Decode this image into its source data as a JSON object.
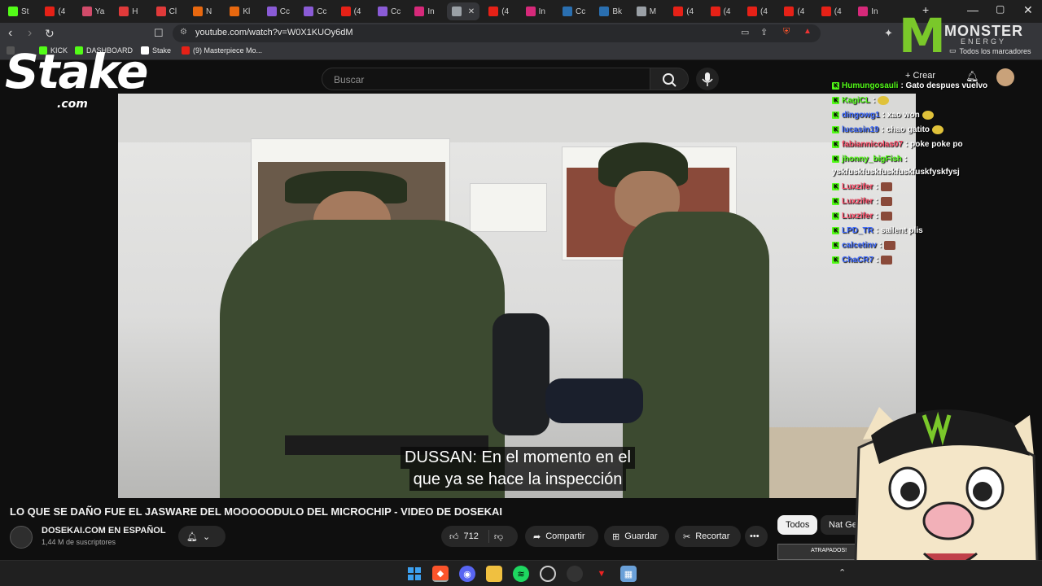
{
  "tabs": [
    {
      "label": "St",
      "color": "#53fc18"
    },
    {
      "label": "(4",
      "color": "#e62117"
    },
    {
      "label": "Ya",
      "color": "#d14b6a"
    },
    {
      "label": "H",
      "color": "#e03a3a"
    },
    {
      "label": "Cl",
      "color": "#e03a3a"
    },
    {
      "label": "N",
      "color": "#e8680f"
    },
    {
      "label": "Kl",
      "color": "#e8680f"
    },
    {
      "label": "Cc",
      "color": "#8a5bd6"
    },
    {
      "label": "Cc",
      "color": "#8a5bd6"
    },
    {
      "label": "(4",
      "color": "#e62117"
    },
    {
      "label": "Cc",
      "color": "#8a5bd6"
    },
    {
      "label": "In",
      "color": "#d6297a"
    },
    {
      "label": "",
      "color": "#9aa0a6",
      "active": true
    },
    {
      "label": "(4",
      "color": "#e62117"
    },
    {
      "label": "In",
      "color": "#d6297a"
    },
    {
      "label": "Cc",
      "color": "#2a6fb0"
    },
    {
      "label": "Bk",
      "color": "#2a6fb0"
    },
    {
      "label": "M",
      "color": "#9aa0a6"
    },
    {
      "label": "(4",
      "color": "#e62117"
    },
    {
      "label": "(4",
      "color": "#e62117"
    },
    {
      "label": "(4",
      "color": "#e62117"
    },
    {
      "label": "(4",
      "color": "#e62117"
    },
    {
      "label": "(4",
      "color": "#e62117"
    },
    {
      "label": "In",
      "color": "#d6297a"
    }
  ],
  "address": {
    "url": "youtube.com/watch?v=W0X1KUOy6dM"
  },
  "bookmarks": [
    {
      "label": "KICK",
      "color": "#53fc18"
    },
    {
      "label": "DASHBOARD",
      "color": "#53fc18"
    },
    {
      "label": "Stake",
      "color": "#1a2c38"
    },
    {
      "label": "(9) Masterpiece Mo...",
      "color": "#e62117"
    }
  ],
  "bookmarks_all": "Todos los marcadores",
  "search": {
    "placeholder": "Buscar"
  },
  "create_label": "Crear",
  "stake": {
    "word": "Stake",
    "domain": ".com"
  },
  "monster": {
    "word": "MONSTER",
    "sub": "ENERGY"
  },
  "chat": [
    {
      "user": "Humungosauli",
      "msg": ": Gato despues vuelvo",
      "color": "#53fc18",
      "emote": false
    },
    {
      "user": "KagiCL",
      "msg": ":",
      "color": "#53fc18",
      "emote": true
    },
    {
      "user": "dingowg1",
      "msg": ": xao won",
      "color": "#3f6bff",
      "emote": true
    },
    {
      "user": "lucasin19",
      "msg": ": chao gatito",
      "color": "#3f6bff",
      "emote": true
    },
    {
      "user": "fabiannicolas07",
      "msg": ": poke poke po",
      "color": "#ff4e6a",
      "emote": false
    },
    {
      "user": "jhonny_bigFish",
      "msg": ":",
      "color": "#53fc18",
      "emote": false
    },
    {
      "user": "",
      "msg": "yskfuskfuskfuskfuskfuskfyskfysj",
      "color": "#fff",
      "emote": false
    },
    {
      "user": "Luxzifer",
      "msg": ":",
      "color": "#ff4e6a",
      "emote": true
    },
    {
      "user": "Luxzifer",
      "msg": ":",
      "color": "#ff4e6a",
      "emote": true
    },
    {
      "user": "Luxzifer",
      "msg": ":",
      "color": "#ff4e6a",
      "emote": true
    },
    {
      "user": "LPD_TR",
      "msg": ": sailent plis",
      "color": "#3f6bff",
      "emote": false
    },
    {
      "user": "calcetinv",
      "msg": ":",
      "color": "#3f6bff",
      "emote": true
    },
    {
      "user": "ChaCR7",
      "msg": ":",
      "color": "#3f6bff",
      "emote": true
    }
  ],
  "video": {
    "subtitle_line1": "DUSSAN: En el momento en el",
    "subtitle_line2": "que ya se hace la inspección"
  },
  "title": "LO QUE SE DAÑO FUE EL JASWARE DEL MOOOOODULO DEL MICROCHIP - VIDEO DE DOSEKAI",
  "channel": {
    "name": "DOSEKAI.COM EN ESPAÑOL",
    "subscribers": "1,44 M de suscriptores"
  },
  "actions": {
    "likes": "712",
    "share": "Compartir",
    "save": "Guardar",
    "clip": "Recortar"
  },
  "chips": [
    "Todos",
    "Nat Geo"
  ],
  "thumb_label": "ATRAPADOS!",
  "colors": {
    "kick": "#53fc18",
    "monster": "#7ac82a",
    "youtube_red": "#ff0000"
  }
}
